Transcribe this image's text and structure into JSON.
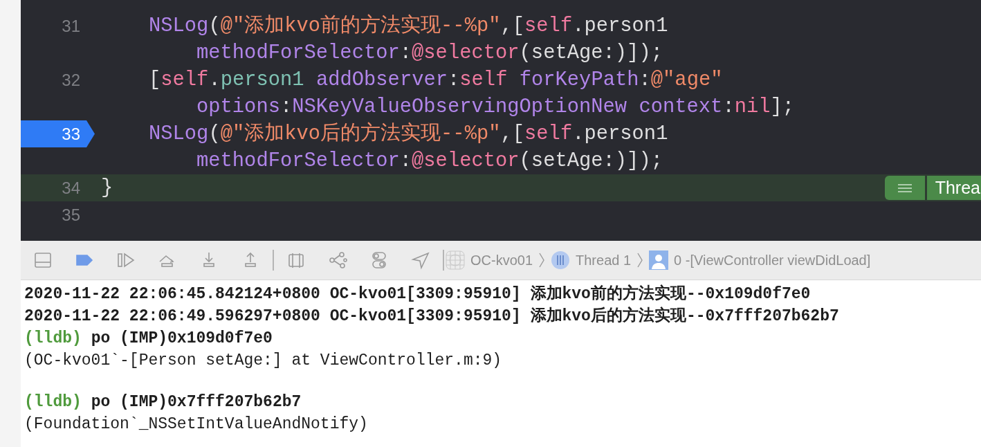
{
  "editor": {
    "lines": [
      {
        "number": "31",
        "breakpoint": false,
        "highlighted": false,
        "rows": [
          {
            "tokens": [
              {
                "kind": "method",
                "text": "NSLog"
              },
              {
                "kind": "plain",
                "text": "("
              },
              {
                "kind": "string",
                "text": "@\"添加kvo前的方法实现--%p\""
              },
              {
                "kind": "plain",
                "text": ",["
              },
              {
                "kind": "keyword",
                "text": "self"
              },
              {
                "kind": "plain",
                "text": ".person1"
              }
            ]
          },
          {
            "tokens": [
              {
                "kind": "method",
                "text": "methodForSelector"
              },
              {
                "kind": "plain",
                "text": ":"
              },
              {
                "kind": "keyword",
                "text": "@selector"
              },
              {
                "kind": "plain",
                "text": "(setAge:)]);"
              }
            ]
          }
        ]
      },
      {
        "number": "32",
        "breakpoint": false,
        "highlighted": false,
        "rows": [
          {
            "tokens": [
              {
                "kind": "plain",
                "text": "["
              },
              {
                "kind": "keyword",
                "text": "self"
              },
              {
                "kind": "plain",
                "text": "."
              },
              {
                "kind": "property",
                "text": "person1 "
              },
              {
                "kind": "method",
                "text": "addObserver"
              },
              {
                "kind": "plain",
                "text": ":"
              },
              {
                "kind": "keyword",
                "text": "self "
              },
              {
                "kind": "method",
                "text": "forKeyPath"
              },
              {
                "kind": "plain",
                "text": ":"
              },
              {
                "kind": "string",
                "text": "@\"age\""
              }
            ]
          },
          {
            "tokens": [
              {
                "kind": "method",
                "text": "options"
              },
              {
                "kind": "plain",
                "text": ":"
              },
              {
                "kind": "method",
                "text": "NSKeyValueObservingOptionNew "
              },
              {
                "kind": "method",
                "text": "context"
              },
              {
                "kind": "plain",
                "text": ":"
              },
              {
                "kind": "keyword",
                "text": "nil"
              },
              {
                "kind": "plain",
                "text": "];"
              }
            ]
          }
        ]
      },
      {
        "number": "33",
        "breakpoint": true,
        "highlighted": false,
        "rows": [
          {
            "tokens": [
              {
                "kind": "method",
                "text": "NSLog"
              },
              {
                "kind": "plain",
                "text": "("
              },
              {
                "kind": "string",
                "text": "@\"添加kvo后的方法实现--%p\""
              },
              {
                "kind": "plain",
                "text": ",["
              },
              {
                "kind": "keyword",
                "text": "self"
              },
              {
                "kind": "plain",
                "text": ".person1"
              }
            ]
          },
          {
            "tokens": [
              {
                "kind": "method",
                "text": "methodForSelector"
              },
              {
                "kind": "plain",
                "text": ":"
              },
              {
                "kind": "keyword",
                "text": "@selector"
              },
              {
                "kind": "plain",
                "text": "(setAge:)]);"
              }
            ]
          }
        ]
      },
      {
        "number": "34",
        "breakpoint": false,
        "highlighted": true,
        "outdent": true,
        "rows": [
          {
            "tokens": [
              {
                "kind": "plain",
                "text": "}"
              }
            ]
          }
        ],
        "badge": "Threa"
      },
      {
        "number": "35",
        "breakpoint": false,
        "highlighted": false
      }
    ]
  },
  "debug_bar": {
    "tools": [
      {
        "kind": "panel"
      },
      {
        "kind": "breakpoints",
        "active": true
      },
      {
        "kind": "continue"
      },
      {
        "kind": "step_over"
      },
      {
        "kind": "step_in"
      },
      {
        "kind": "step_out"
      },
      {
        "kind": "separator"
      },
      {
        "kind": "view_debugger"
      },
      {
        "kind": "memory_graph"
      },
      {
        "kind": "environment"
      },
      {
        "kind": "location"
      },
      {
        "kind": "separator"
      }
    ],
    "breadcrumb": [
      {
        "kind": "app",
        "text": "OC-kvo01"
      },
      {
        "kind": "thread",
        "text": "Thread 1"
      },
      {
        "kind": "frame",
        "text": "0 -[ViewController viewDidLoad]"
      }
    ]
  },
  "console": {
    "lines": [
      {
        "kind": "output",
        "text": "2020-11-22 22:06:45.842124+0800 OC-kvo01[3309:95910] 添加kvo前的方法实现--0x109d0f7e0"
      },
      {
        "kind": "output",
        "text": "2020-11-22 22:06:49.596297+0800 OC-kvo01[3309:95910] 添加kvo后的方法实现--0x7fff207b62b7"
      },
      {
        "kind": "prompt",
        "prompt": "(lldb)",
        "text": "po (IMP)0x109d0f7e0"
      },
      {
        "kind": "result",
        "text": "(OC-kvo01`-[Person setAge:] at ViewController.m:9)"
      },
      {
        "kind": "blank"
      },
      {
        "kind": "prompt",
        "prompt": "(lldb)",
        "text": "po (IMP)0x7fff207b62b7"
      },
      {
        "kind": "result",
        "text": "(Foundation`_NSSetIntValueAndNotify)"
      }
    ]
  }
}
